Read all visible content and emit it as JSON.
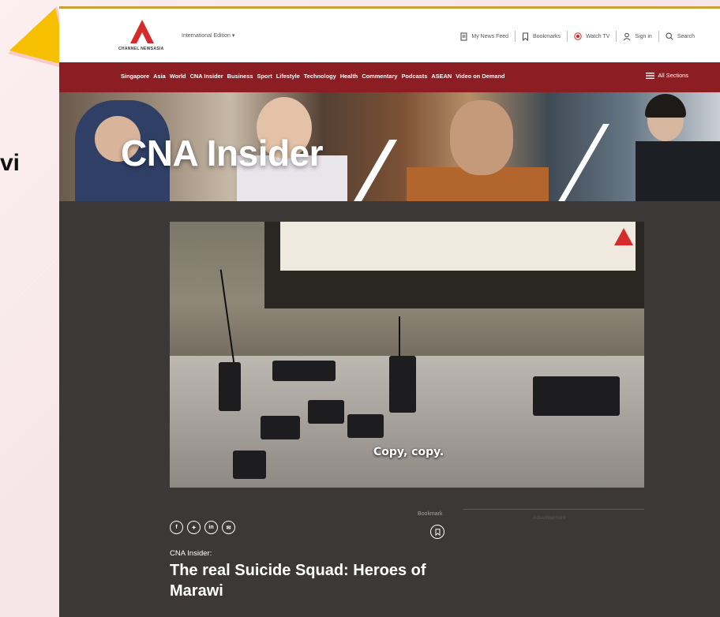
{
  "slide": {
    "fragment_text": "vi"
  },
  "brand": {
    "logo_text": "CHANNEL NEWSASIA",
    "accent": "#8c1d22",
    "logo_red": "#d52b2b"
  },
  "header": {
    "edition": "International Edition",
    "actions": [
      {
        "icon": "newsfeed-icon",
        "label": "My News Feed"
      },
      {
        "icon": "bookmark-icon",
        "label": "Bookmarks"
      },
      {
        "icon": "live-icon",
        "label": "Watch TV"
      },
      {
        "icon": "user-icon",
        "label": "Sign in"
      },
      {
        "icon": "search-icon",
        "label": "Search"
      }
    ]
  },
  "nav": {
    "items": [
      "Singapore",
      "Asia",
      "World",
      "CNA Insider",
      "Business",
      "Sport",
      "Lifestyle",
      "Technology",
      "Health",
      "Commentary",
      "Podcasts",
      "ASEAN",
      "Video on Demand"
    ],
    "all_sections": "All Sections"
  },
  "hero": {
    "title": "CNA Insider"
  },
  "video": {
    "caption": "Copy, copy."
  },
  "share": {
    "icons": [
      "facebook-icon",
      "twitter-icon",
      "linkedin-icon",
      "email-icon"
    ]
  },
  "bookmark": {
    "label": "Bookmark"
  },
  "ad": {
    "label": "Advertisement"
  },
  "article": {
    "kicker": "CNA Insider:",
    "headline": "The real Suicide Squad: Heroes of Marawi"
  }
}
